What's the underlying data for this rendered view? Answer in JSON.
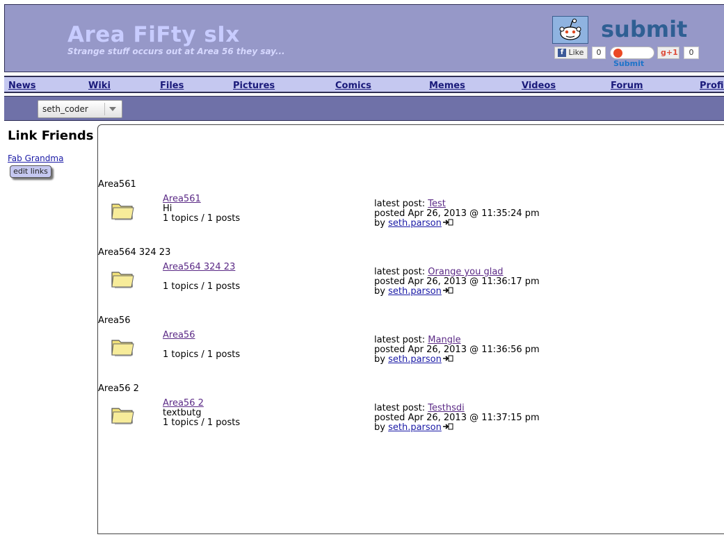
{
  "header": {
    "title": "Area FiFty sIx",
    "subtitle": "Strange stuff occurs out at Area 56 they say...",
    "submit_text": "submit",
    "share": {
      "like_label": "Like",
      "like_count": "0",
      "stumble_label": "Submit",
      "plusone_label": "+1",
      "plusone_count": "0"
    }
  },
  "nav": {
    "items": [
      "News",
      "Wiki",
      "Files",
      "Pictures",
      "Comics",
      "Memes",
      "Videos",
      "Forum",
      "Profil"
    ]
  },
  "userbar": {
    "selected_user": "seth_coder"
  },
  "sidebar": {
    "title": "Link Friends",
    "link": "Fab Grandma",
    "edit_button": "edit links"
  },
  "forums": [
    {
      "group": "Area561",
      "name": "Area561",
      "description": "Hi",
      "stats": "1 topics / 1 posts",
      "latest_label": "latest post:",
      "latest_post": "Test",
      "posted": "posted Apr 26, 2013 @ 11:35:24 pm",
      "by_label": "by",
      "author": "seth.parson"
    },
    {
      "group": "Area564 324 23",
      "name": "Area564 324 23",
      "description": "",
      "stats": "1 topics / 1 posts",
      "latest_label": "latest post:",
      "latest_post": "Orange you glad",
      "posted": "posted Apr 26, 2013 @ 11:36:17 pm",
      "by_label": "by",
      "author": "seth.parson"
    },
    {
      "group": "Area56",
      "name": "Area56",
      "description": "",
      "stats": "1 topics / 1 posts",
      "latest_label": "latest post:",
      "latest_post": "Mangle",
      "posted": "posted Apr 26, 2013 @ 11:36:56 pm",
      "by_label": "by",
      "author": "seth.parson"
    },
    {
      "group": "Area56 2",
      "name": "Area56 2",
      "description": "textbutg",
      "stats": "1 topics / 1 posts",
      "latest_label": "latest post:",
      "latest_post": "Testhsdi",
      "posted": "posted Apr 26, 2013 @ 11:37:15 pm",
      "by_label": "by",
      "author": "seth.parson"
    }
  ],
  "colors": {
    "header_bg": "#9698c8",
    "nav_bg": "#c5c8f0",
    "userbar_bg": "#6f71a8",
    "link": "#1a1aa6",
    "visited_link": "#5b2a86"
  }
}
